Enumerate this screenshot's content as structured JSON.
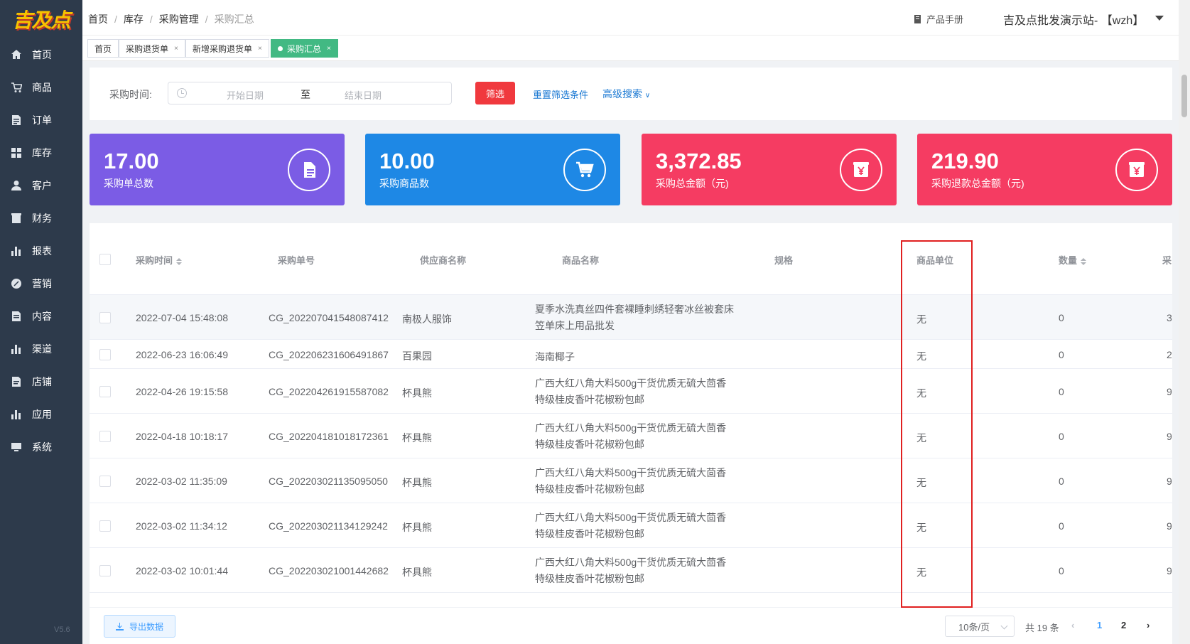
{
  "sidebar": {
    "logo": "吉及点",
    "items": [
      {
        "label": "首页",
        "icon": "home-icon"
      },
      {
        "label": "商品",
        "icon": "cart-icon"
      },
      {
        "label": "订单",
        "icon": "order-icon"
      },
      {
        "label": "库存",
        "icon": "grid-icon"
      },
      {
        "label": "客户",
        "icon": "user-icon"
      },
      {
        "label": "财务",
        "icon": "finance-icon"
      },
      {
        "label": "报表",
        "icon": "bar-chart-icon"
      },
      {
        "label": "营销",
        "icon": "percent-icon"
      },
      {
        "label": "内容",
        "icon": "document-icon"
      },
      {
        "label": "渠道",
        "icon": "bar-chart-icon"
      },
      {
        "label": "店铺",
        "icon": "shop-icon"
      },
      {
        "label": "应用",
        "icon": "bar-chart-icon"
      },
      {
        "label": "系统",
        "icon": "monitor-icon"
      }
    ],
    "version": "V5.6"
  },
  "header": {
    "breadcrumb": [
      "首页",
      "库存",
      "采购管理",
      "采购汇总"
    ],
    "manual": "产品手册",
    "site": "吉及点批发演示站- 【wzh】"
  },
  "tabs": [
    {
      "label": "首页"
    },
    {
      "label": "采购退货单"
    },
    {
      "label": "新增采购退货单"
    },
    {
      "label": "采购汇总"
    }
  ],
  "filter": {
    "label": "采购时间:",
    "start_placeholder": "开始日期",
    "to": "至",
    "end_placeholder": "结束日期",
    "button": "筛选",
    "reset": "重置筛选条件",
    "advanced": "高级搜索"
  },
  "cards": [
    {
      "value": "17.00",
      "label": "采购单总数",
      "color": "#7b5ce5",
      "icon": "document-icon"
    },
    {
      "value": "10.00",
      "label": "采购商品数",
      "color": "#1e88e5",
      "icon": "cart-icon"
    },
    {
      "value": "3,372.85",
      "label": "采购总金额（元)",
      "color": "#f53c62",
      "icon": "yen-icon"
    },
    {
      "value": "219.90",
      "label": "采购退款总金额（元)",
      "color": "#f53c62",
      "icon": "yen-icon"
    }
  ],
  "table": {
    "headers": {
      "time": "采购时间",
      "order_no": "采购单号",
      "supplier": "供应商名称",
      "product": "商品名称",
      "spec": "规格",
      "unit": "商品单位",
      "qty": "数量",
      "partial": "采"
    },
    "rows": [
      {
        "time": "2022-07-04 15:48:08",
        "order_no": "CG_202207041548087412",
        "supplier": "南极人服饰",
        "product": [
          "夏季水洗真丝四件套裸睡刺绣轻奢冰丝被套床",
          "笠单床上用品批发"
        ],
        "unit": "无",
        "qty": "0",
        "partial": "3"
      },
      {
        "time": "2022-06-23 16:06:49",
        "order_no": "CG_202206231606491867",
        "supplier": "百果园",
        "product": [
          "海南椰子"
        ],
        "unit": "无",
        "qty": "0",
        "partial": "2"
      },
      {
        "time": "2022-04-26 19:15:58",
        "order_no": "CG_202204261915587082",
        "supplier": "杯具熊",
        "product": [
          "广西大红八角大料500g干货优质无硫大茴香",
          "特级桂皮香叶花椒粉包邮"
        ],
        "unit": "无",
        "qty": "0",
        "partial": "9"
      },
      {
        "time": "2022-04-18 10:18:17",
        "order_no": "CG_202204181018172361",
        "supplier": "杯具熊",
        "product": [
          "广西大红八角大料500g干货优质无硫大茴香",
          "特级桂皮香叶花椒粉包邮"
        ],
        "unit": "无",
        "qty": "0",
        "partial": "9"
      },
      {
        "time": "2022-03-02 11:35:09",
        "order_no": "CG_202203021135095050",
        "supplier": "杯具熊",
        "product": [
          "广西大红八角大料500g干货优质无硫大茴香",
          "特级桂皮香叶花椒粉包邮"
        ],
        "unit": "无",
        "qty": "0",
        "partial": "9"
      },
      {
        "time": "2022-03-02 11:34:12",
        "order_no": "CG_202203021134129242",
        "supplier": "杯具熊",
        "product": [
          "广西大红八角大料500g干货优质无硫大茴香",
          "特级桂皮香叶花椒粉包邮"
        ],
        "unit": "无",
        "qty": "0",
        "partial": "9"
      },
      {
        "time": "2022-03-02 10:01:44",
        "order_no": "CG_202203021001442682",
        "supplier": "杯具熊",
        "product": [
          "广西大红八角大料500g干货优质无硫大茴香",
          "特级桂皮香叶花椒粉包邮"
        ],
        "unit": "无",
        "qty": "0",
        "partial": "9"
      }
    ]
  },
  "footer": {
    "export": "导出数据",
    "page_size": "10条/页",
    "total": "共 19 条",
    "pages": [
      "1",
      "2"
    ],
    "current_page": "1"
  }
}
